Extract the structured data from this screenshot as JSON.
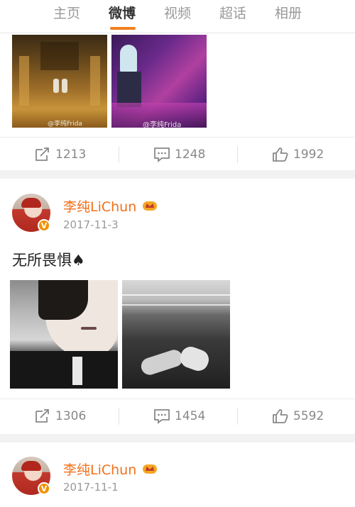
{
  "tabs": [
    {
      "label": "主页",
      "active": false
    },
    {
      "label": "微博",
      "active": true
    },
    {
      "label": "视频",
      "active": false
    },
    {
      "label": "超话",
      "active": false
    },
    {
      "label": "相册",
      "active": false
    }
  ],
  "accent_color": "#f2801f",
  "username_color": "#f2711c",
  "post0": {
    "watermark_1": "@李纯Frida",
    "watermark_2": "@李纯Frida",
    "reposts": "1213",
    "comments": "1248",
    "likes": "1992"
  },
  "post1": {
    "user": "李纯LiChun",
    "verified_badge": "V",
    "date": "2017-11-3",
    "text": "无所畏惧♠",
    "reposts": "1306",
    "comments": "1454",
    "likes": "5592"
  },
  "post2": {
    "user": "李纯LiChun",
    "verified_badge": "V",
    "date": "2017-11-1"
  },
  "icons": [
    "repost-icon",
    "comment-icon",
    "like-icon",
    "crown-icon",
    "verified-icon"
  ]
}
